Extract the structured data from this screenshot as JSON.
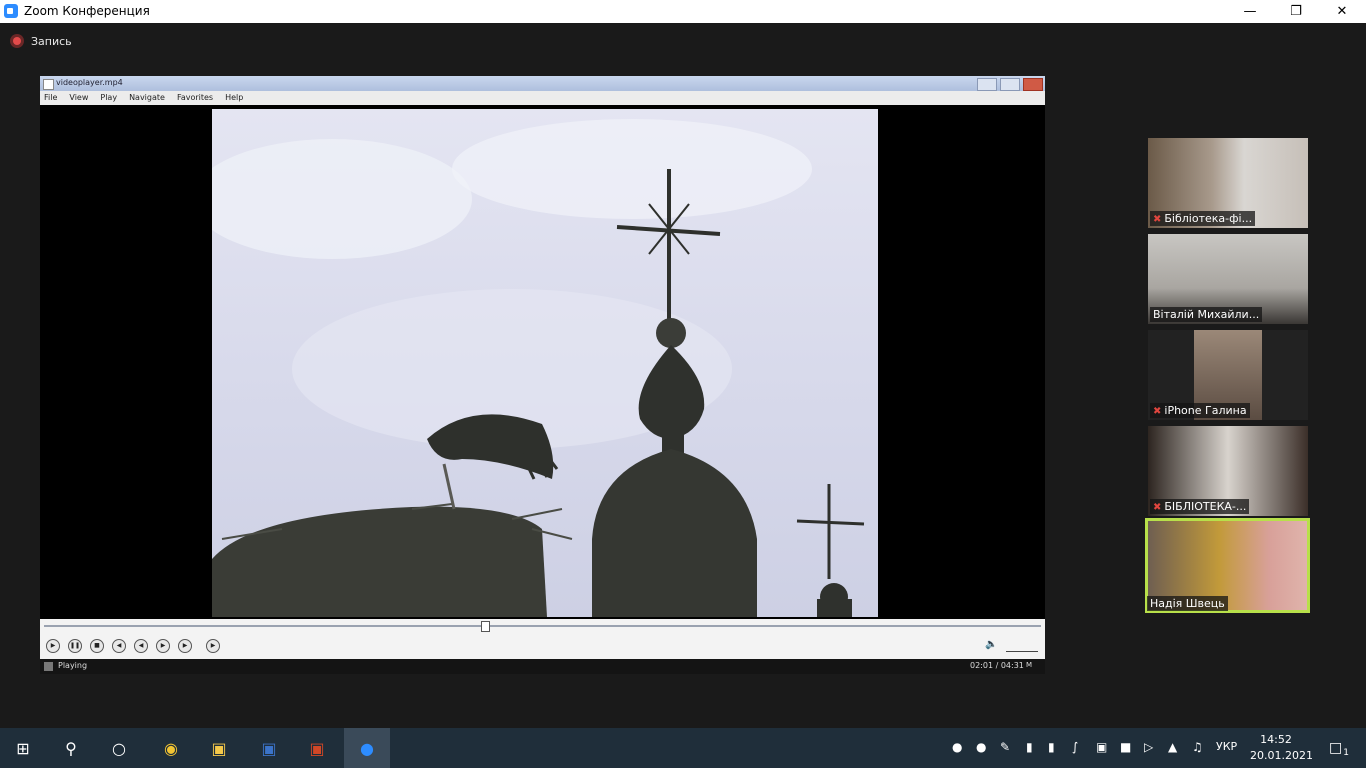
{
  "window": {
    "title": "Zoom Конференция",
    "minimize_icon": "minimize-icon",
    "maximize_icon": "maximize-icon",
    "close_icon": "close-icon"
  },
  "recording": {
    "label": "Запись",
    "color": "#e34b4b"
  },
  "shared_screen": {
    "player": {
      "title": "videoplayer.mp4",
      "menu": [
        "File",
        "View",
        "Play",
        "Navigate",
        "Favorites",
        "Help"
      ],
      "controls": [
        "play",
        "pause",
        "stop",
        "prev",
        "rewind",
        "fast-forward",
        "next",
        "frame-step"
      ],
      "status": "Playing",
      "time": "02:01 / 04:31",
      "mode": "M"
    }
  },
  "participants": [
    {
      "name": "Бібліотека-фі...",
      "muted": true,
      "active": false
    },
    {
      "name": "Віталій Михайли...",
      "muted": false,
      "active": false
    },
    {
      "name": "iPhone Галина",
      "muted": true,
      "active": false
    },
    {
      "name": "БІБЛІОТЕКА-...",
      "muted": true,
      "active": false
    },
    {
      "name": "Надія Швець",
      "muted": false,
      "active": true,
      "highlight_color": "#b8e04a"
    }
  ],
  "taskbar": {
    "apps": [
      "windows-start-icon",
      "search-icon",
      "task-view-icon",
      "chrome-icon",
      "file-explorer-icon",
      "word-icon",
      "powerpoint-icon",
      "zoom-icon"
    ],
    "tray": {
      "language": "УКР",
      "time": "14:52",
      "date": "20.01.2021",
      "notifications": "1"
    }
  }
}
